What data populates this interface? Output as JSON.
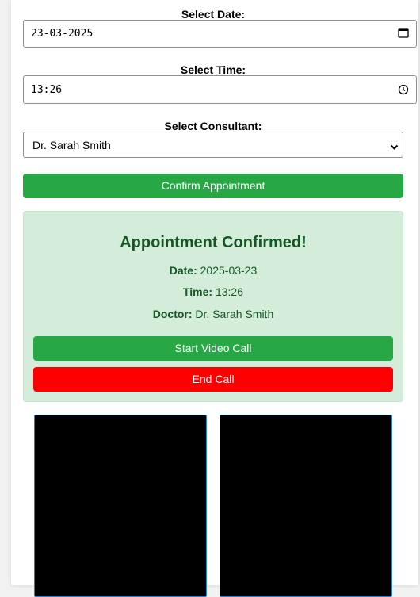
{
  "form": {
    "date_label": "Select Date:",
    "date_value": "23-03-2025",
    "time_label": "Select Time:",
    "time_value": "13:26",
    "consultant_label": "Select Consultant:",
    "consultant_value": "Dr. Sarah Smith",
    "confirm_button": "Confirm Appointment"
  },
  "confirmation": {
    "title": "Appointment Confirmed!",
    "date_key": "Date:",
    "date_value": "2025-03-23",
    "time_key": "Time:",
    "time_value": "13:26",
    "doctor_key": "Doctor:",
    "doctor_value": "Dr. Sarah Smith",
    "start_call_button": "Start Video Call",
    "end_call_button": "End Call"
  },
  "colors": {
    "green": "#28a745",
    "red": "#ff0000",
    "confirm_bg": "#d4edda",
    "confirm_text": "#155724"
  },
  "icons": {
    "date": "calendar-icon",
    "time": "clock-icon",
    "select": "chevron-down-icon"
  }
}
